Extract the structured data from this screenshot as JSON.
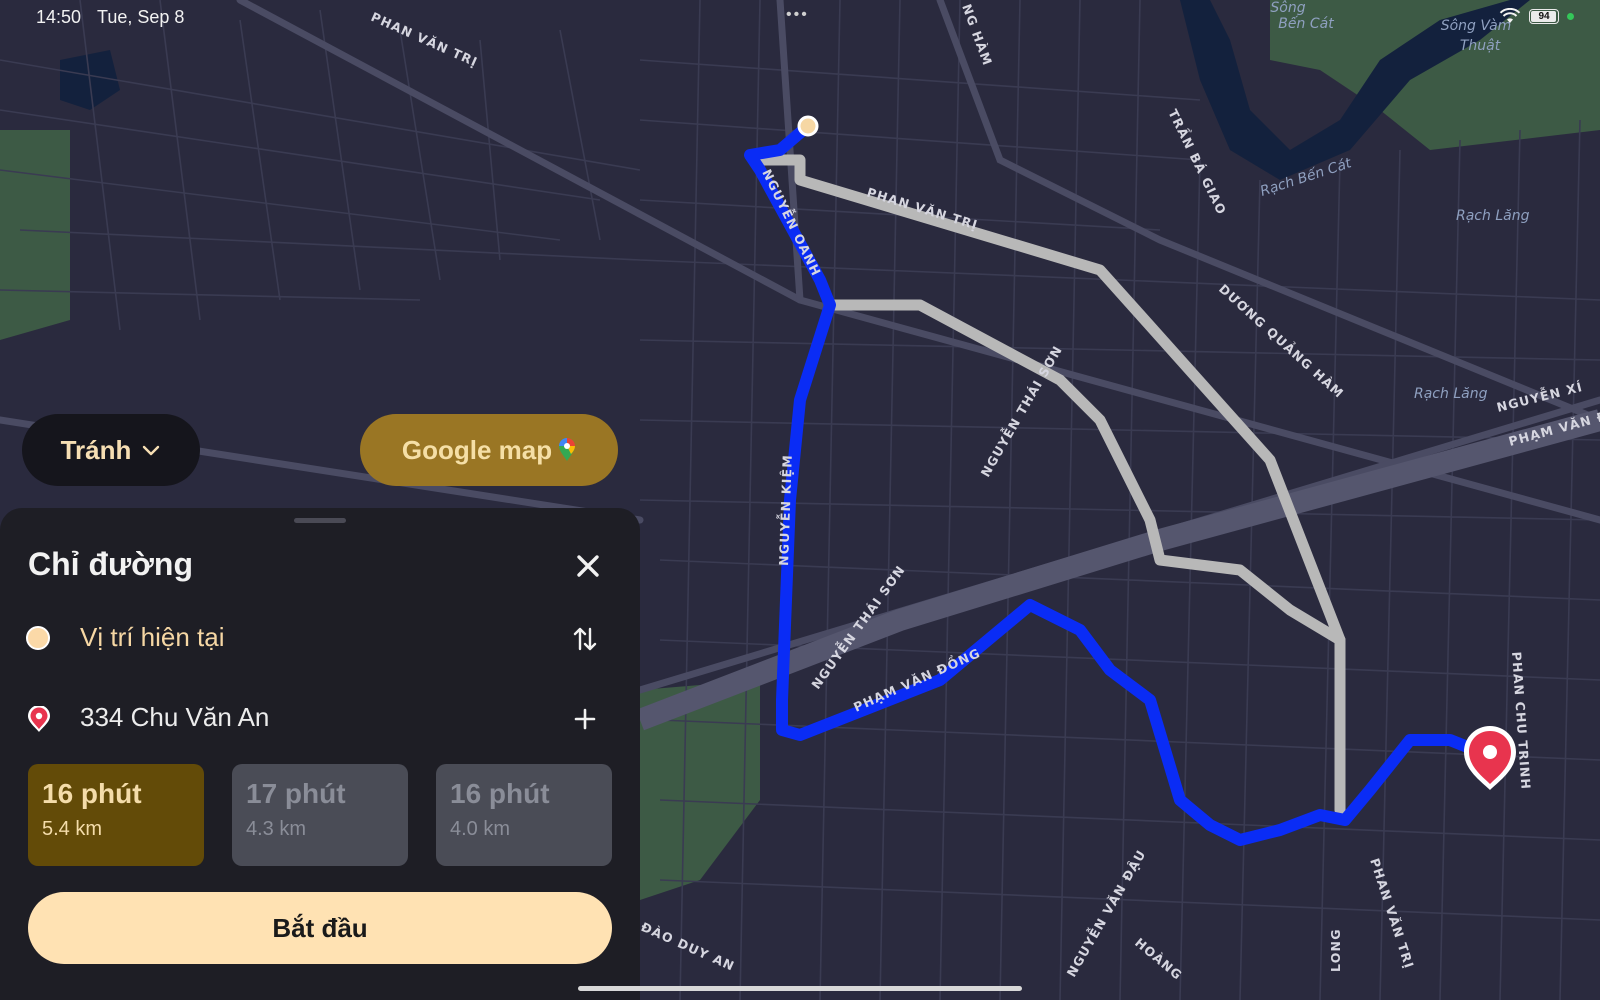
{
  "status_bar": {
    "time": "14:50",
    "date": "Tue, Sep 8",
    "battery": "94",
    "dots": "•••"
  },
  "map": {
    "street_labels": {
      "phan_van_tri_top": "PHAN VĂN TRỊ",
      "phan_van_tri_mid": "PHAN VĂN TRỊ",
      "phan_van_tri_bottom": "PHAN VĂN TRỊ",
      "nguyen_oanh": "NGUYỄN OANH",
      "nguyen_kiem": "NGUYỄN KIỆM",
      "nguyen_thai_son_1": "NGUYỄN THÁI SƠN",
      "nguyen_thai_son_2": "NGUYỄN THÁI SƠN",
      "pham_van_dong_route": "PHẠM VĂN ĐỒNG",
      "pham_van_dong_right": "PHẠM VĂN Đ",
      "duong_quang_ham": "DƯƠNG QUẢNG HÀM",
      "tran_ba_giao": "TRẦN BÁ GIAO",
      "nguyen_xi": "NGUYỄN XÍ",
      "phan_chu_trinh": "PHAN CHU TRINH",
      "nguyen_van_dau": "NGUYỄN VĂN ĐẬU",
      "dao_duy_anh": "ĐÀO DUY AN",
      "hoang": "HOÀNG",
      "long": "LONG",
      "ng_ham": "NG HÀM"
    },
    "water_labels": {
      "song_ben_cat": "Sông\nBến Cát",
      "song_vam_thuat": "Sông Vàm\nThuật",
      "rach_ben_cat": "Rạch Bến Cát",
      "rach_lang_1": "Rạch Lăng",
      "rach_lang_2": "Rạch Lăng"
    },
    "colors": {
      "route_primary": "#0a2cf5",
      "route_alt": "#b8b8b8",
      "origin": "#f6d7a4",
      "destination": "#e8344e"
    }
  },
  "buttons": {
    "avoid_label": "Tránh",
    "google_map_label": "Google map"
  },
  "sheet": {
    "title": "Chỉ đường",
    "origin": "Vị trí hiện tại",
    "destination": "334 Chu Văn An",
    "options": [
      {
        "time": "16 phút",
        "distance": "5.4 km",
        "selected": true
      },
      {
        "time": "17 phút",
        "distance": "4.3 km",
        "selected": false
      },
      {
        "time": "16 phút",
        "distance": "4.0 km",
        "selected": false
      }
    ],
    "start_label": "Bắt đầu"
  }
}
